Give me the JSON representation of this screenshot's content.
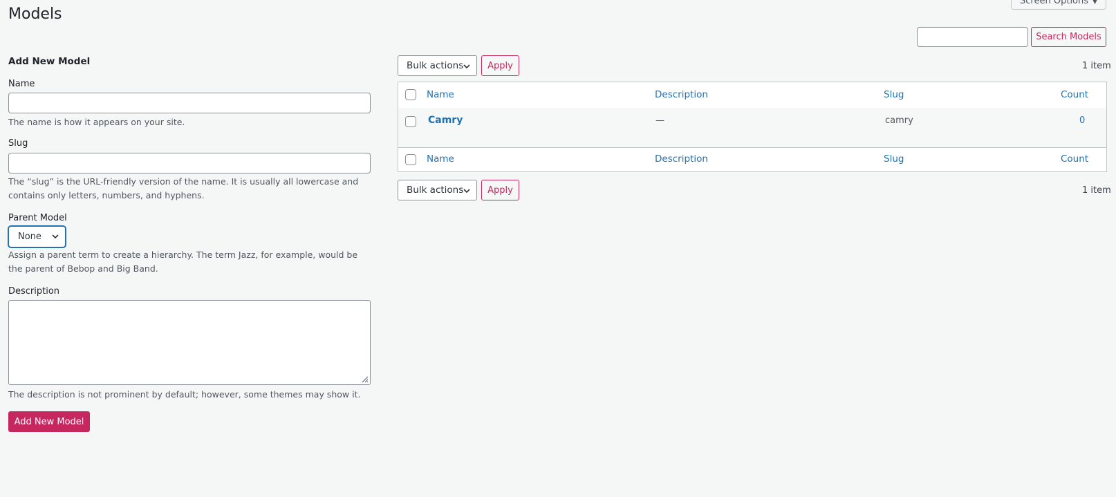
{
  "page": {
    "title": "Models",
    "screen_options_label": "Screen Options"
  },
  "search": {
    "button_label": "Search Models",
    "value": ""
  },
  "form": {
    "section_title": "Add New Model",
    "name_label": "Name",
    "name_value": "",
    "name_help": "The name is how it appears on your site.",
    "slug_label": "Slug",
    "slug_value": "",
    "slug_help": "The “slug” is the URL-friendly version of the name. It is usually all lowercase and contains only letters, numbers, and hyphens.",
    "parent_label": "Parent Model",
    "parent_selected": "None",
    "parent_help": "Assign a parent term to create a hierarchy. The term Jazz, for example, would be the parent of Bebop and Big Band.",
    "description_label": "Description",
    "description_value": "",
    "description_help": "The description is not prominent by default; however, some themes may show it.",
    "submit_label": "Add New Model"
  },
  "list": {
    "bulk_actions_label": "Bulk actions",
    "apply_label": "Apply",
    "item_count": "1 item",
    "columns": {
      "name": "Name",
      "description": "Description",
      "slug": "Slug",
      "count": "Count"
    },
    "rows": [
      {
        "name": "Camry",
        "description": "—",
        "slug": "camry",
        "count": "0"
      }
    ]
  },
  "colors": {
    "accent": "#c7275f",
    "link": "#2271b1",
    "background": "#f5f6f6"
  }
}
